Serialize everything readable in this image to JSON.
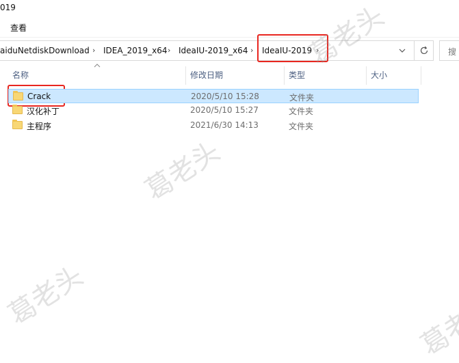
{
  "window": {
    "title": "019"
  },
  "ribbon": {
    "view_tab": "查看"
  },
  "address": {
    "crumbs": [
      "aiduNetdiskDownload",
      "IDEA_2019_x64",
      "IdeaIU-2019_x64",
      "IdeaIU-2019"
    ],
    "separator": "›",
    "dropdown_icon": "chevron-down-icon",
    "refresh_icon": "refresh-icon"
  },
  "search": {
    "placeholder": "搜"
  },
  "columns": {
    "name": "名称",
    "date": "修改日期",
    "type": "类型",
    "size": "大小"
  },
  "files": [
    {
      "name": "Crack",
      "date": "2020/5/10 15:28",
      "type": "文件夹",
      "selected": true
    },
    {
      "name": "汉化补丁",
      "date": "2020/5/10 15:27",
      "type": "文件夹",
      "selected": false
    },
    {
      "name": "主程序",
      "date": "2021/6/30 14:13",
      "type": "文件夹",
      "selected": false
    }
  ],
  "watermark": {
    "text": "葛老头"
  },
  "colors": {
    "selection_bg": "#cce8ff",
    "highlight_red": "#e8261f",
    "header_text": "#4d6082",
    "folder": "#f8d775"
  }
}
